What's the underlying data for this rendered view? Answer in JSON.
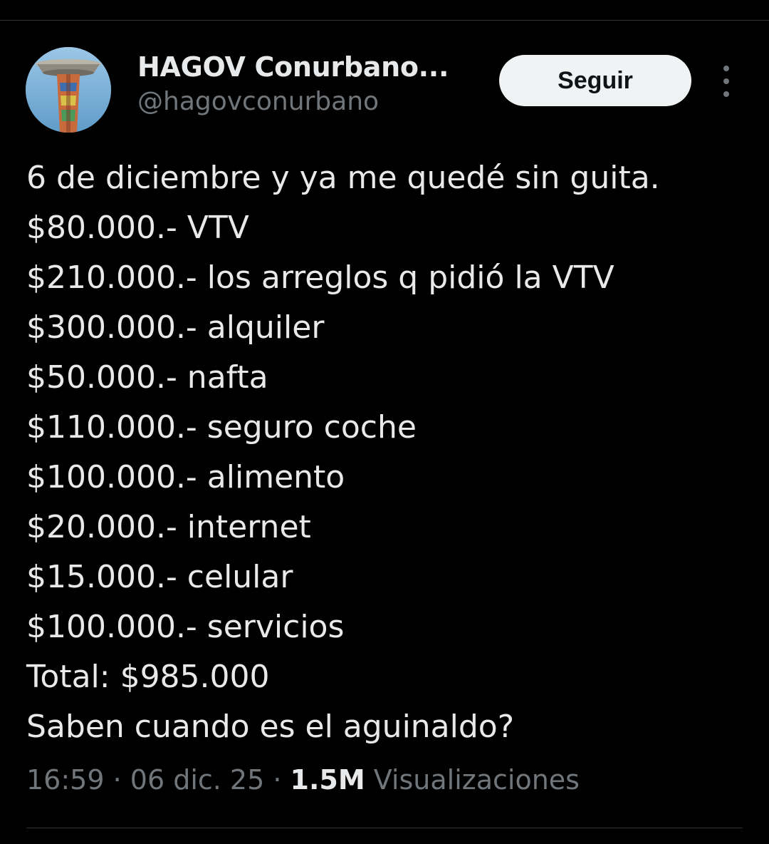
{
  "author": {
    "display_name": "HAGOV Conurbano...",
    "handle": "@hagovconurbano",
    "avatar_icon": "water-tower-avatar"
  },
  "actions": {
    "follow_label": "Seguir",
    "more_icon": "more-vertical-icon"
  },
  "tweet": {
    "lines": [
      "6 de diciembre y ya me quedé sin guita.",
      "$80.000.- VTV",
      "$210.000.- los arreglos q pidió la VTV",
      "$300.000.- alquiler",
      "$50.000.- nafta",
      "$110.000.- seguro coche",
      "$100.000.- alimento",
      "$20.000.- internet",
      "$15.000.- celular",
      "$100.000.- servicios",
      "Total: $985.000",
      "Saben cuando es el aguinaldo?"
    ]
  },
  "meta": {
    "time": "16:59",
    "separator": " · ",
    "date": "06 dic. 25",
    "views_count": "1.5M",
    "views_label": "Visualizaciones"
  },
  "colors": {
    "background": "#000000",
    "text_primary": "#e7e9ea",
    "text_secondary": "#71767b",
    "button_bg": "#eff3f4",
    "button_text": "#0f1419",
    "divider": "#2f3336"
  }
}
